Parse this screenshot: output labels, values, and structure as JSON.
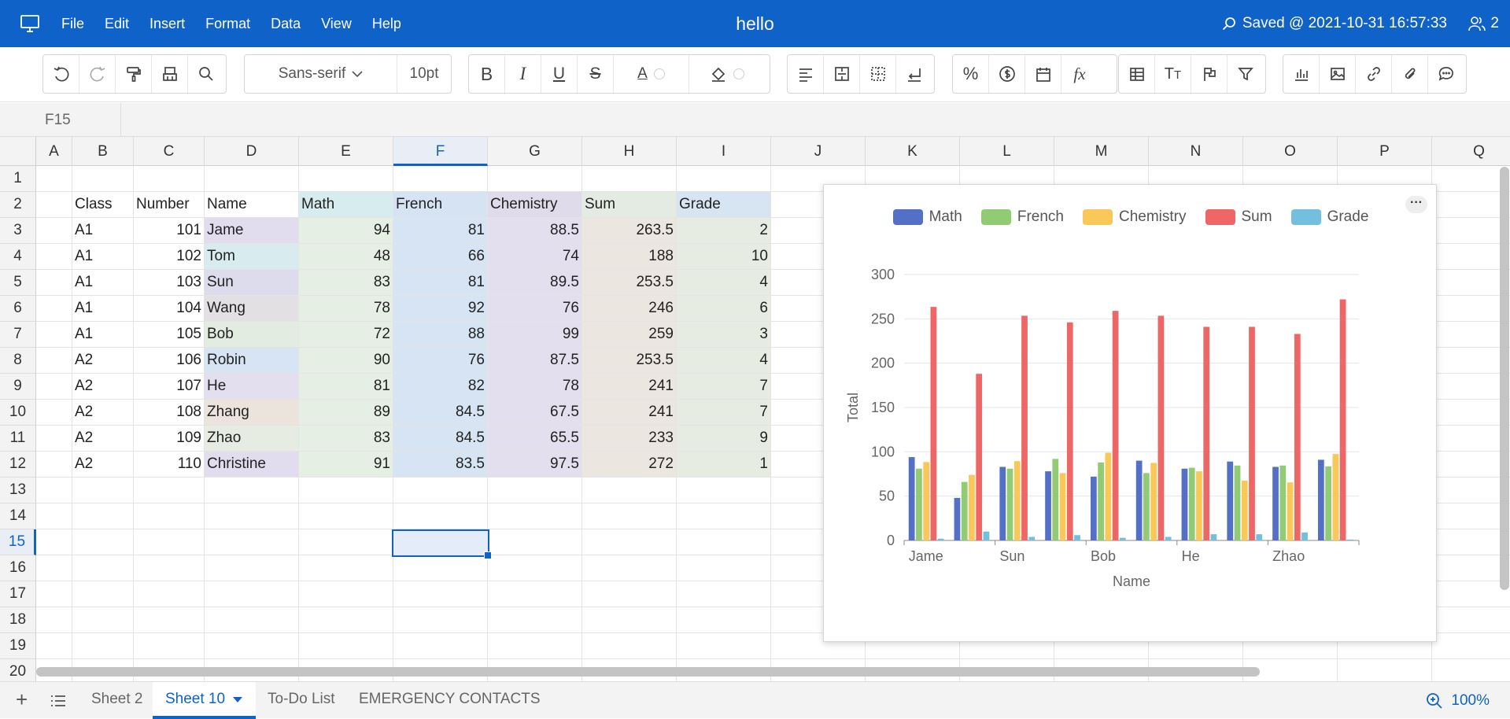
{
  "titlebar": {
    "title": "hello",
    "menu": [
      "File",
      "Edit",
      "Insert",
      "Format",
      "Data",
      "View",
      "Help"
    ],
    "saved": "Saved @ 2021-10-31 16:57:33",
    "users": "2",
    "bg_color": "#0f62c8"
  },
  "toolbar": {
    "font_name": "Sans-serif",
    "font_size": "10pt"
  },
  "formula_bar": {
    "cell_ref": "F15"
  },
  "sheet": {
    "columns": [
      "A",
      "B",
      "C",
      "D",
      "E",
      "F",
      "G",
      "H",
      "I",
      "J",
      "K",
      "L",
      "M",
      "N",
      "O",
      "P",
      "Q"
    ],
    "selected_column": "F",
    "rows": [
      "1",
      "2",
      "3",
      "4",
      "5",
      "6",
      "7",
      "8",
      "9",
      "10",
      "11",
      "12",
      "13",
      "14",
      "15",
      "16",
      "17",
      "18",
      "19",
      "20"
    ],
    "selected_row": "15",
    "headers": [
      "Class",
      "Number",
      "Name",
      "Math",
      "French",
      "Chemistry",
      "Sum",
      "Grade"
    ],
    "data": [
      [
        "A1",
        "101",
        "Jame",
        "94",
        "81",
        "88.5",
        "263.5",
        "2"
      ],
      [
        "A1",
        "102",
        "Tom",
        "48",
        "66",
        "74",
        "188",
        "10"
      ],
      [
        "A1",
        "103",
        "Sun",
        "83",
        "81",
        "89.5",
        "253.5",
        "4"
      ],
      [
        "A1",
        "104",
        "Wang",
        "78",
        "92",
        "76",
        "246",
        "6"
      ],
      [
        "A1",
        "105",
        "Bob",
        "72",
        "88",
        "99",
        "259",
        "3"
      ],
      [
        "A2",
        "106",
        "Robin",
        "90",
        "76",
        "87.5",
        "253.5",
        "4"
      ],
      [
        "A2",
        "107",
        "He",
        "81",
        "82",
        "78",
        "241",
        "7"
      ],
      [
        "A2",
        "108",
        "Zhang",
        "89",
        "84.5",
        "67.5",
        "241",
        "7"
      ],
      [
        "A2",
        "109",
        "Zhao",
        "83",
        "84.5",
        "65.5",
        "233",
        "9"
      ],
      [
        "A2",
        "110",
        "Christine",
        "91",
        "83.5",
        "97.5",
        "272",
        "1"
      ]
    ]
  },
  "chart_data": {
    "type": "bar",
    "categories": [
      "Jame",
      "Tom",
      "Sun",
      "Wang",
      "Bob",
      "Robin",
      "He",
      "Zhang",
      "Zhao",
      "Christine"
    ],
    "tick_labels": [
      "Jame",
      "Sun",
      "Bob",
      "He",
      "Zhao"
    ],
    "series": [
      {
        "name": "Math",
        "color": "#5470c6",
        "values": [
          94,
          48,
          83,
          78,
          72,
          90,
          81,
          89,
          83,
          91
        ]
      },
      {
        "name": "French",
        "color": "#91cc75",
        "values": [
          81,
          66,
          81,
          92,
          88,
          76,
          82,
          84.5,
          84.5,
          83.5
        ]
      },
      {
        "name": "Chemistry",
        "color": "#fac858",
        "values": [
          88.5,
          74,
          89.5,
          76,
          99,
          87.5,
          78,
          67.5,
          65.5,
          97.5
        ]
      },
      {
        "name": "Sum",
        "color": "#ee6666",
        "values": [
          263.5,
          188,
          253.5,
          246,
          259,
          253.5,
          241,
          241,
          233,
          272
        ]
      },
      {
        "name": "Grade",
        "color": "#73c0de",
        "values": [
          2,
          10,
          4,
          6,
          3,
          4,
          7,
          7,
          9,
          1
        ]
      }
    ],
    "xlabel": "Name",
    "ylabel": "Total",
    "ylim": [
      0,
      300
    ],
    "yticks": [
      "0",
      "50",
      "100",
      "150",
      "200",
      "250",
      "300"
    ],
    "grid": true,
    "legend": "top-center"
  },
  "bottom": {
    "tabs": [
      "Sheet 2",
      "Sheet 10",
      "To-Do List",
      "EMERGENCY CONTACTS"
    ],
    "active_tab": "Sheet 10",
    "zoom": "100%"
  }
}
